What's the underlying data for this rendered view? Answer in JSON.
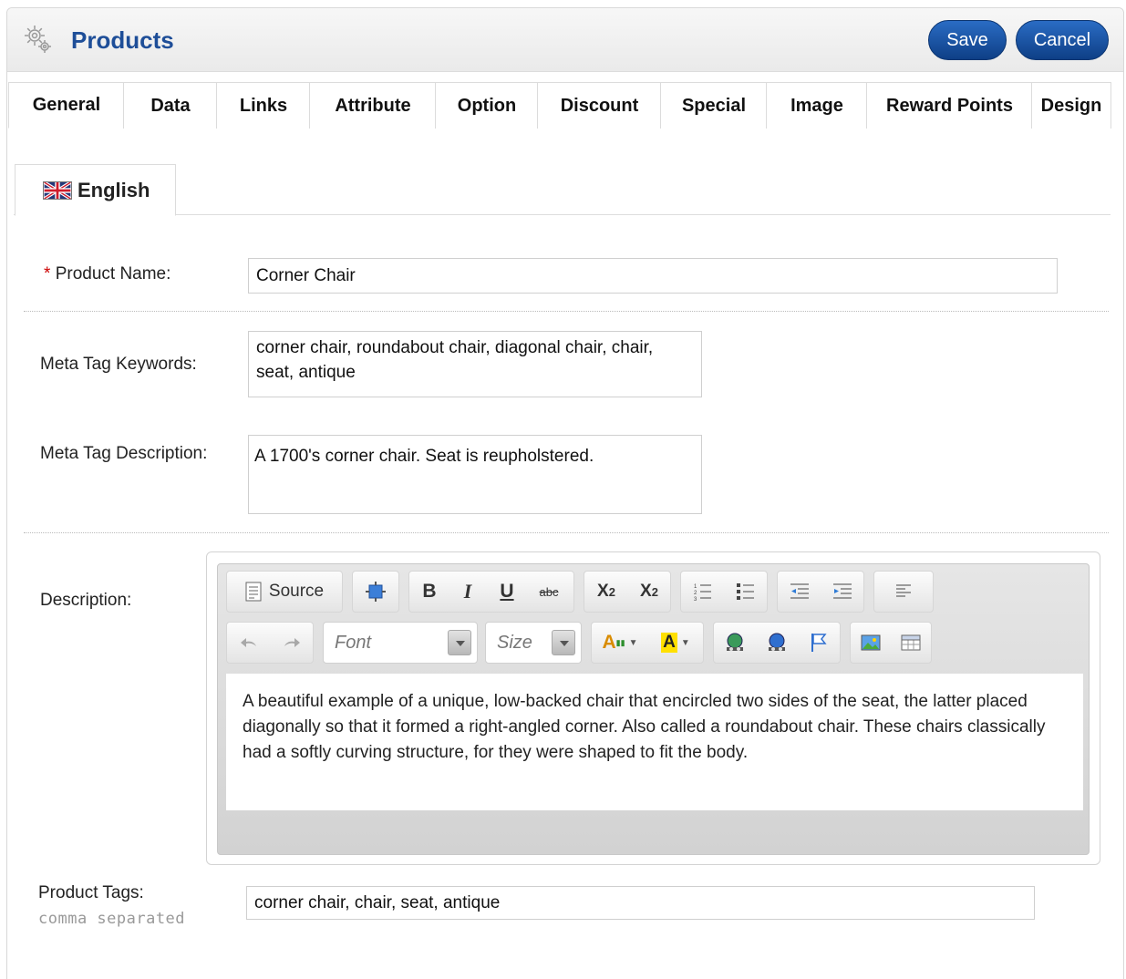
{
  "header": {
    "title": "Products",
    "save_label": "Save",
    "cancel_label": "Cancel",
    "icon": "gear-icon"
  },
  "tabs": [
    {
      "label": "General",
      "active": true
    },
    {
      "label": "Data"
    },
    {
      "label": "Links"
    },
    {
      "label": "Attribute"
    },
    {
      "label": "Option"
    },
    {
      "label": "Discount"
    },
    {
      "label": "Special"
    },
    {
      "label": "Image"
    },
    {
      "label": "Reward Points"
    },
    {
      "label": "Design"
    }
  ],
  "language_tab": {
    "label": "English",
    "icon": "uk-flag-icon"
  },
  "form": {
    "product_name": {
      "required_mark": "*",
      "label": "Product Name:",
      "value": "Corner Chair"
    },
    "meta_keywords": {
      "label": "Meta Tag Keywords:",
      "value": "corner chair, roundabout chair, diagonal chair, chair, seat, antique"
    },
    "meta_description": {
      "label": "Meta Tag Description:",
      "value": "A 1700's corner chair. Seat is reupholstered."
    },
    "description": {
      "label": "Description:",
      "toolbar": {
        "source_label": "Source",
        "font_placeholder": "Font",
        "size_placeholder": "Size"
      },
      "content": "A beautiful example of a unique, low-backed chair that encircled two sides of the seat, the latter placed diagonally so that it formed a right-angled corner. Also called a roundabout chair. These chairs classically had a softly curving structure, for they were shaped to fit the body."
    },
    "product_tags": {
      "label": "Product Tags:",
      "hint": "comma separated",
      "value": "corner chair, chair, seat, antique"
    }
  },
  "colors": {
    "accent": "#1e4e98",
    "button": "#1a56a8",
    "required": "#cc0000"
  }
}
